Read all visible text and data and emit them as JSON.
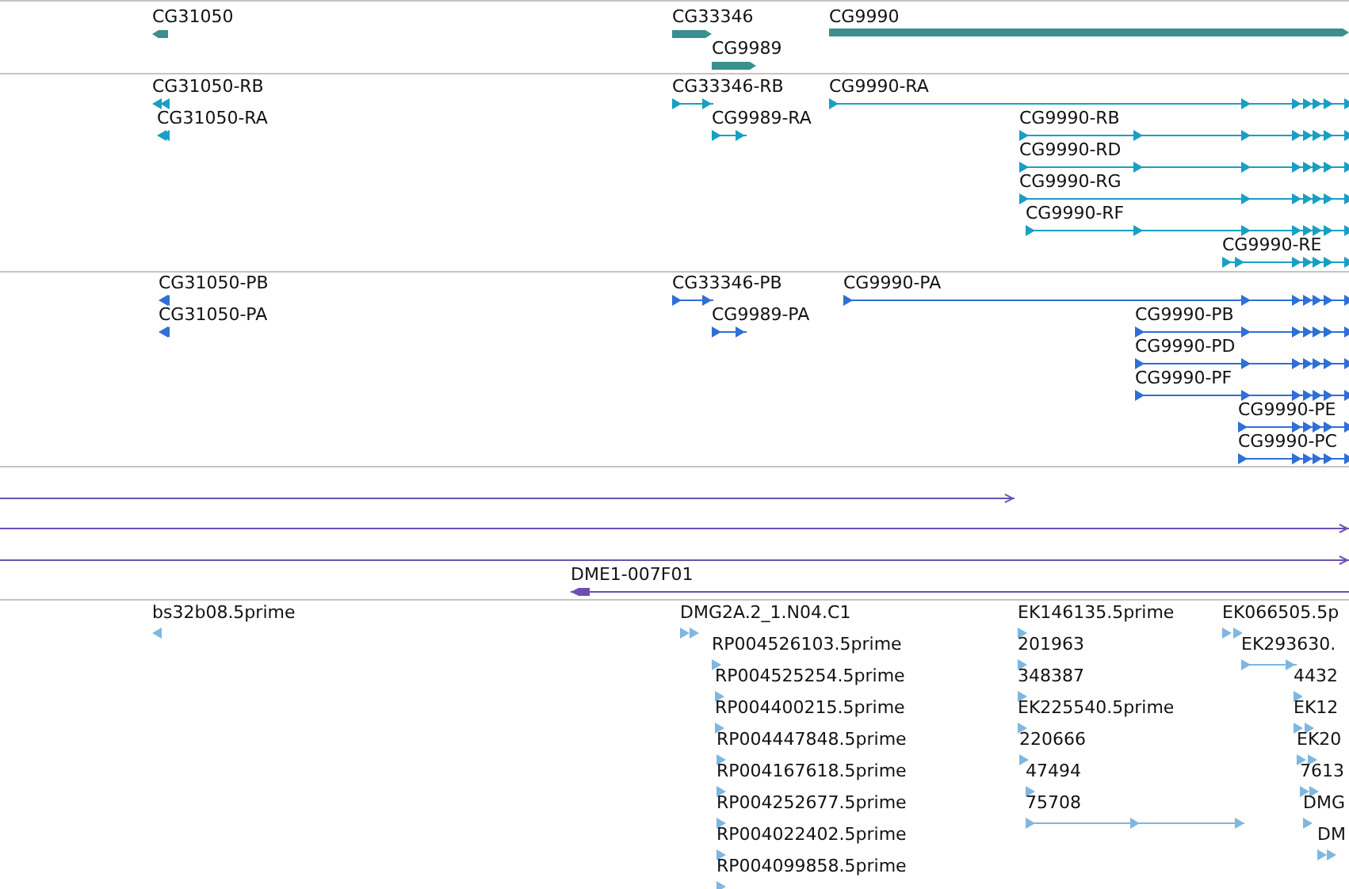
{
  "tracks": [
    {
      "kind": "gene",
      "features": [
        {
          "label": "CG31050",
          "reverse": true
        },
        {
          "label": "CG33346",
          "reverse": false
        },
        {
          "label": "CG9989",
          "reverse": false
        },
        {
          "label": "CG9990",
          "reverse": false
        }
      ]
    },
    {
      "kind": "transcript",
      "features": [
        {
          "label": "CG31050-RB",
          "reverse": true
        },
        {
          "label": "CG31050-RA",
          "reverse": true
        },
        {
          "label": "CG33346-RB",
          "reverse": false
        },
        {
          "label": "CG9989-RA",
          "reverse": false
        },
        {
          "label": "CG9990-RA",
          "reverse": false
        },
        {
          "label": "CG9990-RB",
          "reverse": false
        },
        {
          "label": "CG9990-RD",
          "reverse": false
        },
        {
          "label": "CG9990-RG",
          "reverse": false
        },
        {
          "label": "CG9990-RF",
          "reverse": false
        },
        {
          "label": "CG9990-RE",
          "reverse": false
        }
      ]
    },
    {
      "kind": "protein",
      "features": [
        {
          "label": "CG31050-PB",
          "reverse": true
        },
        {
          "label": "CG31050-PA",
          "reverse": true
        },
        {
          "label": "CG33346-PB",
          "reverse": false
        },
        {
          "label": "CG9989-PA",
          "reverse": false
        },
        {
          "label": "CG9990-PA",
          "reverse": false
        },
        {
          "label": "CG9990-PB",
          "reverse": false
        },
        {
          "label": "CG9990-PD",
          "reverse": false
        },
        {
          "label": "CG9990-PF",
          "reverse": false
        },
        {
          "label": "CG9990-PE",
          "reverse": false
        },
        {
          "label": "CG9990-PC",
          "reverse": false
        }
      ]
    },
    {
      "kind": "alignment",
      "features": [
        {
          "reverse": false
        },
        {
          "reverse": false
        },
        {
          "reverse": false
        },
        {
          "label": "DME1-007F01",
          "reverse": true
        }
      ]
    },
    {
      "kind": "est",
      "features": [
        {
          "label": "bs32b08.5prime",
          "reverse": true
        },
        {
          "label": "DMG2A.2_1.N04.C1",
          "reverse": false
        },
        {
          "label": "RP004526103.5prime",
          "reverse": false
        },
        {
          "label": "RP004525254.5prime",
          "reverse": false
        },
        {
          "label": "RP004400215.5prime",
          "reverse": false
        },
        {
          "label": "RP004447848.5prime",
          "reverse": false
        },
        {
          "label": "RP004167618.5prime",
          "reverse": false
        },
        {
          "label": "RP004252677.5prime",
          "reverse": false
        },
        {
          "label": "RP004022402.5prime",
          "reverse": false
        },
        {
          "label": "RP004099858.5prime",
          "reverse": false
        },
        {
          "label": "EK146135.5prime",
          "reverse": false
        },
        {
          "label": "201963",
          "reverse": false
        },
        {
          "label": "348387",
          "reverse": false
        },
        {
          "label": "EK225540.5prime",
          "reverse": false
        },
        {
          "label": "220666",
          "reverse": false
        },
        {
          "label": "47494",
          "reverse": false
        },
        {
          "label": "75708",
          "reverse": false
        },
        {
          "label": "EK066505.5p",
          "reverse": false
        },
        {
          "label": "EK293630.",
          "reverse": false
        },
        {
          "label": "4432",
          "reverse": false
        },
        {
          "label": "EK12",
          "reverse": false
        },
        {
          "label": "EK20",
          "reverse": false
        },
        {
          "label": "7613",
          "reverse": false
        },
        {
          "label": "DMG",
          "reverse": false
        },
        {
          "label": "DM",
          "reverse": false
        }
      ]
    }
  ]
}
